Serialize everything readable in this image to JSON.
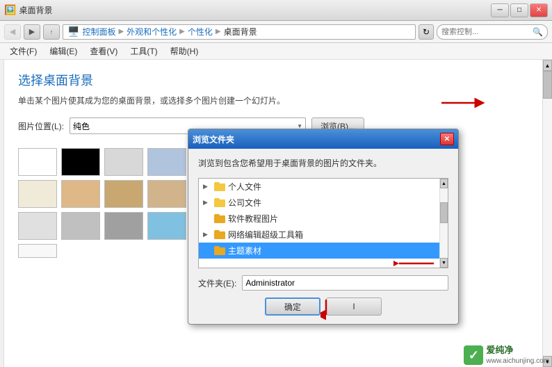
{
  "titleBar": {
    "title": "桌面背景",
    "minBtn": "─",
    "maxBtn": "□",
    "closeBtn": "✕"
  },
  "navBar": {
    "backBtn": "◀",
    "forwardBtn": "▶",
    "breadcrumb": [
      {
        "label": "控制面板",
        "sep": "▶"
      },
      {
        "label": "外观和个性化",
        "sep": "▶"
      },
      {
        "label": "个性化",
        "sep": "▶"
      },
      {
        "label": "桌面背景",
        "sep": ""
      }
    ],
    "refreshBtn": "↻",
    "searchPlaceholder": "搜索控制..."
  },
  "menuBar": {
    "items": [
      "文件(F)",
      "编辑(E)",
      "查看(V)",
      "工具(T)",
      "帮助(H)"
    ]
  },
  "content": {
    "title": "选择桌面背景",
    "desc": "单击某个图片使其成为您的桌面背景，或选择多个图片创建一个幻灯片。",
    "imageLocationLabel": "图片位置(L):",
    "imageLocationValue": "纯色",
    "browseBtn": "浏览(B)...",
    "colors": [
      "#ffffff",
      "#000000",
      "#d0d0d0",
      "#b0c4de",
      "#87ceeb",
      "#6495ed",
      "#a8d8a8",
      "#5b9a5b",
      "#f5f5dc",
      "#deb887",
      "#c8a870",
      "#d2b48c",
      "#8b7355",
      "#708090",
      "#5f9ea0",
      "#4682b4",
      "#e0e0e0",
      "#c0c0c0",
      "#a0a0a0",
      "#80c0e0",
      "#4090c0",
      "#20a020"
    ]
  },
  "dialog": {
    "title": "浏览文件夹",
    "closeBtn": "✕",
    "desc": "浏览到包含您希望用于桌面背景的图片的文件夹。",
    "treeItems": [
      {
        "label": "个人文件",
        "hasArrow": true,
        "expanded": false,
        "indent": 0
      },
      {
        "label": "公司文件",
        "hasArrow": true,
        "expanded": false,
        "indent": 0
      },
      {
        "label": "软件教程图片",
        "hasArrow": false,
        "expanded": false,
        "indent": 0
      },
      {
        "label": "网络编辑超级工具箱",
        "hasArrow": true,
        "expanded": false,
        "indent": 0
      },
      {
        "label": "主题素材",
        "hasArrow": false,
        "expanded": false,
        "indent": 0,
        "selected": true
      }
    ],
    "folderLabel": "文件夹(E):",
    "folderValue": "Administrator",
    "okBtn": "确定",
    "cancelBtn": "I"
  },
  "watermark": {
    "text": "www.aichunjing.com"
  },
  "icons": {
    "folder": "📁",
    "search": "🔍"
  }
}
